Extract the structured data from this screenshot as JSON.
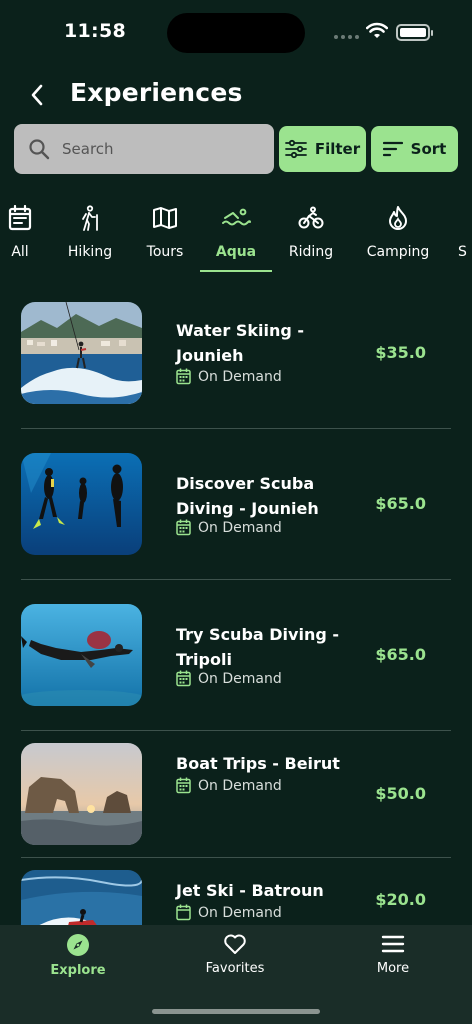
{
  "status_bar": {
    "time": "11:58"
  },
  "header": {
    "title": "Experiences"
  },
  "search": {
    "placeholder": "Search",
    "value": ""
  },
  "toolbar": {
    "filter_label": "Filter",
    "sort_label": "Sort"
  },
  "categories": [
    {
      "label": "All",
      "icon": "calendar-icon"
    },
    {
      "label": "Hiking",
      "icon": "hiker-icon"
    },
    {
      "label": "Tours",
      "icon": "map-icon"
    },
    {
      "label": "Aqua",
      "icon": "swimmer-icon",
      "active": true
    },
    {
      "label": "Riding",
      "icon": "bicycle-icon"
    },
    {
      "label": "Camping",
      "icon": "flame-icon"
    },
    {
      "label": "S",
      "icon": ""
    }
  ],
  "experiences": [
    {
      "title": "Water Skiing - Jounieh",
      "availability": "On Demand",
      "price": "$35.0"
    },
    {
      "title": "Discover Scuba Diving - Jounieh",
      "availability": "On Demand",
      "price": "$65.0"
    },
    {
      "title": "Try Scuba Diving - Tripoli",
      "availability": "On Demand",
      "price": "$65.0"
    },
    {
      "title": "Boat Trips - Beirut",
      "availability": "On Demand",
      "price": "$50.0"
    },
    {
      "title": "Jet Ski - Batroun",
      "availability": "On Demand",
      "price": "$20.0"
    }
  ],
  "tabbar": {
    "items": [
      {
        "label": "Explore",
        "icon": "compass-icon",
        "active": true
      },
      {
        "label": "Favorites",
        "icon": "heart-icon"
      },
      {
        "label": "More",
        "icon": "menu-icon"
      }
    ]
  },
  "colors": {
    "background": "#0b211b",
    "accent": "#9be38f",
    "tabbar": "#1a2d28"
  }
}
